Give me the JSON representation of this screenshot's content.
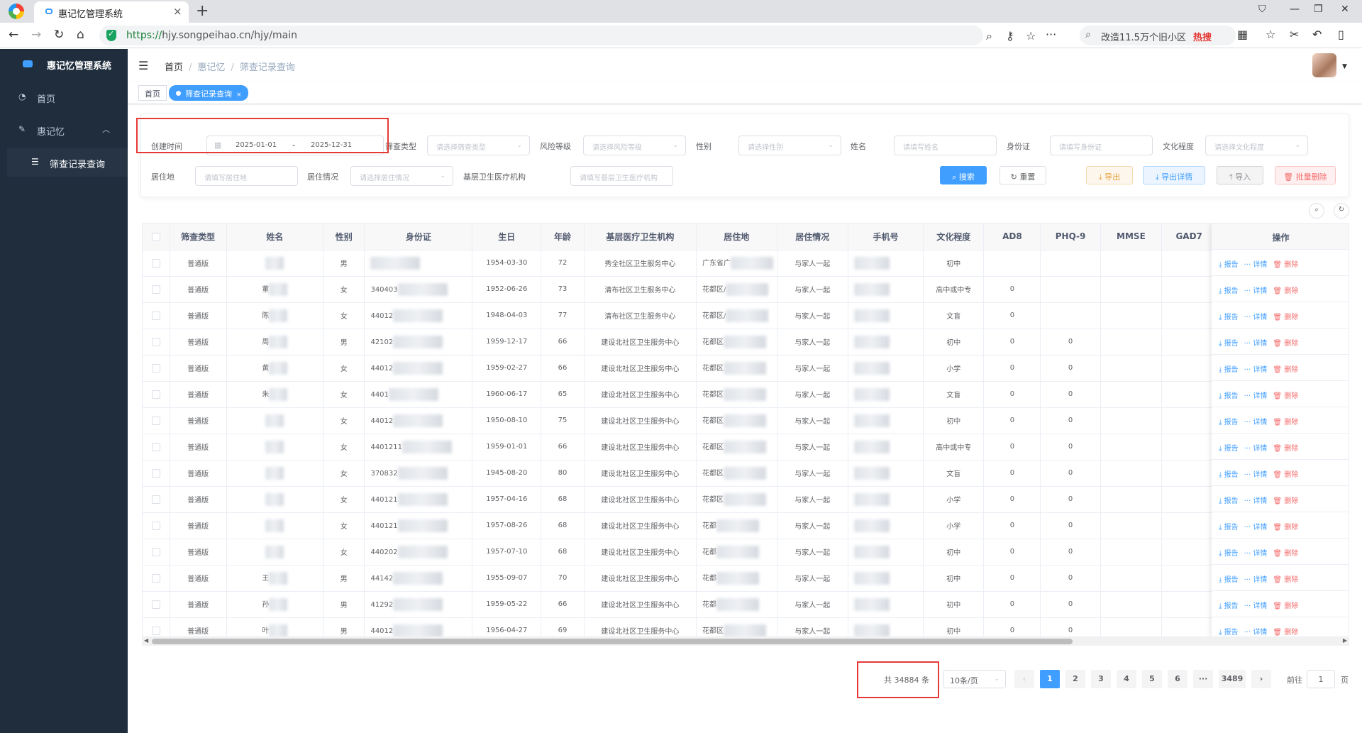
{
  "browser": {
    "tab_title": "惠记忆管理系统",
    "url_secure": "https://",
    "url_host": "hjy.songpeihao.cn",
    "url_path": "/hjy/main",
    "search_text": "改造11.5万个旧小区",
    "search_hot": "热搜"
  },
  "sidebar": {
    "title": "惠记忆管理系统",
    "items": [
      {
        "label": "首页",
        "icon": "dashboard-icon"
      },
      {
        "label": "惠记忆",
        "icon": "brain-icon"
      }
    ],
    "sub_item": {
      "label": "筛查记录查询",
      "icon": "list-icon"
    }
  },
  "header": {
    "breadcrumb": [
      "首页",
      "惠记忆",
      "筛查记录查询"
    ]
  },
  "tags": [
    "首页",
    "筛查记录查询"
  ],
  "filters": {
    "created_label": "创建时间",
    "date_start": "2025-01-01",
    "date_sep": "-",
    "date_end": "2025-12-31",
    "screen_type_label": "筛查类型",
    "screen_type_ph": "请选择筛查类型",
    "risk_label": "风险等级",
    "risk_ph": "请选择风险等级",
    "gender_label": "性别",
    "gender_ph": "请选择性别",
    "name_label": "姓名",
    "name_ph": "请填写姓名",
    "id_label": "身份证",
    "id_ph": "请填写身份证",
    "edu_label": "文化程度",
    "edu_ph": "请选择文化程度",
    "address_label": "居住地",
    "address_ph": "请填写居住地",
    "living_label": "居住情况",
    "living_ph": "请选择居住情况",
    "clinic_label": "基层卫生医疗机构",
    "clinic_ph": "请填写基层卫生医疗机构"
  },
  "buttons": {
    "search": "搜索",
    "reset": "重置",
    "export": "导出",
    "export_detail": "导出详情",
    "import": "导入",
    "batch_delete": "批量删除"
  },
  "table": {
    "headers": [
      "筛查类型",
      "姓名",
      "性别",
      "身份证",
      "生日",
      "年龄",
      "基层医疗卫生机构",
      "居住地",
      "居住情况",
      "手机号",
      "文化程度",
      "AD8",
      "PHQ-9",
      "MMSE",
      "GAD7"
    ],
    "ops_header": "操作",
    "ops": {
      "report": "报告",
      "detail": "详情",
      "delete": "删除"
    },
    "rows": [
      {
        "type": "普通版",
        "name": "",
        "gender": "男",
        "id": "",
        "birth": "1954-03-30",
        "age": "72",
        "clinic": "秀全社区卫生服务中心",
        "addr": "广东省广",
        "living": "与家人一起",
        "phone": "",
        "edu": "初中",
        "ad8": "",
        "phq9": "",
        "mmse": "",
        "gad7": ""
      },
      {
        "type": "普通版",
        "name": "董",
        "gender": "女",
        "id": "340403",
        "birth": "1952-06-26",
        "age": "73",
        "clinic": "清布社区卫生服务中心",
        "addr": "花都区/",
        "living": "与家人一起",
        "phone": "",
        "edu": "高中或中专",
        "ad8": "0",
        "phq9": "",
        "mmse": "",
        "gad7": ""
      },
      {
        "type": "普通版",
        "name": "陈",
        "gender": "女",
        "id": "44012",
        "birth": "1948-04-03",
        "age": "77",
        "clinic": "清布社区卫生服务中心",
        "addr": "花都区/",
        "living": "与家人一起",
        "phone": "",
        "edu": "文盲",
        "ad8": "0",
        "phq9": "",
        "mmse": "",
        "gad7": ""
      },
      {
        "type": "普通版",
        "name": "周",
        "gender": "男",
        "id": "42102",
        "birth": "1959-12-17",
        "age": "66",
        "clinic": "建设北社区卫生服务中心",
        "addr": "花都区",
        "living": "与家人一起",
        "phone": "",
        "edu": "初中",
        "ad8": "0",
        "phq9": "0",
        "mmse": "",
        "gad7": ""
      },
      {
        "type": "普通版",
        "name": "黄",
        "gender": "女",
        "id": "44012",
        "birth": "1959-02-27",
        "age": "66",
        "clinic": "建设北社区卫生服务中心",
        "addr": "花都区",
        "living": "与家人一起",
        "phone": "",
        "edu": "小学",
        "ad8": "0",
        "phq9": "0",
        "mmse": "",
        "gad7": ""
      },
      {
        "type": "普通版",
        "name": "朱",
        "gender": "女",
        "id": "4401",
        "birth": "1960-06-17",
        "age": "65",
        "clinic": "建设北社区卫生服务中心",
        "addr": "花都区",
        "living": "与家人一起",
        "phone": "",
        "edu": "文盲",
        "ad8": "0",
        "phq9": "0",
        "mmse": "",
        "gad7": ""
      },
      {
        "type": "普通版",
        "name": "",
        "gender": "女",
        "id": "44012",
        "birth": "1950-08-10",
        "age": "75",
        "clinic": "建设北社区卫生服务中心",
        "addr": "花都区",
        "living": "与家人一起",
        "phone": "",
        "edu": "初中",
        "ad8": "0",
        "phq9": "0",
        "mmse": "",
        "gad7": ""
      },
      {
        "type": "普通版",
        "name": "",
        "gender": "女",
        "id": "4401211",
        "birth": "1959-01-01",
        "age": "66",
        "clinic": "建设北社区卫生服务中心",
        "addr": "花都区",
        "living": "与家人一起",
        "phone": "",
        "edu": "高中或中专",
        "ad8": "0",
        "phq9": "0",
        "mmse": "",
        "gad7": ""
      },
      {
        "type": "普通版",
        "name": "",
        "gender": "女",
        "id": "370832",
        "birth": "1945-08-20",
        "age": "80",
        "clinic": "建设北社区卫生服务中心",
        "addr": "花都区",
        "living": "与家人一起",
        "phone": "",
        "edu": "文盲",
        "ad8": "0",
        "phq9": "0",
        "mmse": "",
        "gad7": ""
      },
      {
        "type": "普通版",
        "name": "",
        "gender": "女",
        "id": "440121",
        "birth": "1957-04-16",
        "age": "68",
        "clinic": "建设北社区卫生服务中心",
        "addr": "花都区",
        "living": "与家人一起",
        "phone": "",
        "edu": "小学",
        "ad8": "0",
        "phq9": "0",
        "mmse": "",
        "gad7": ""
      },
      {
        "type": "普通版",
        "name": "",
        "gender": "女",
        "id": "440121",
        "birth": "1957-08-26",
        "age": "68",
        "clinic": "建设北社区卫生服务中心",
        "addr": "花都",
        "living": "与家人一起",
        "phone": "",
        "edu": "小学",
        "ad8": "0",
        "phq9": "0",
        "mmse": "",
        "gad7": ""
      },
      {
        "type": "普通版",
        "name": "",
        "gender": "女",
        "id": "440202",
        "birth": "1957-07-10",
        "age": "68",
        "clinic": "建设北社区卫生服务中心",
        "addr": "花都",
        "living": "与家人一起",
        "phone": "",
        "edu": "初中",
        "ad8": "0",
        "phq9": "0",
        "mmse": "",
        "gad7": ""
      },
      {
        "type": "普通版",
        "name": "王",
        "gender": "男",
        "id": "44142",
        "birth": "1955-09-07",
        "age": "70",
        "clinic": "建设北社区卫生服务中心",
        "addr": "花都",
        "living": "与家人一起",
        "phone": "",
        "edu": "初中",
        "ad8": "0",
        "phq9": "0",
        "mmse": "",
        "gad7": ""
      },
      {
        "type": "普通版",
        "name": "孙",
        "gender": "男",
        "id": "41292",
        "birth": "1959-05-22",
        "age": "66",
        "clinic": "建设北社区卫生服务中心",
        "addr": "花都",
        "living": "与家人一起",
        "phone": "",
        "edu": "初中",
        "ad8": "0",
        "phq9": "0",
        "mmse": "",
        "gad7": ""
      },
      {
        "type": "普通版",
        "name": "叶",
        "gender": "男",
        "id": "44012",
        "birth": "1956-04-27",
        "age": "69",
        "clinic": "建设北社区卫生服务中心",
        "addr": "花都区",
        "living": "与家人一起",
        "phone": "",
        "edu": "初中",
        "ad8": "0",
        "phq9": "0",
        "mmse": "",
        "gad7": ""
      }
    ]
  },
  "pagination": {
    "total": "共 34884 条",
    "page_size": "10条/页",
    "pages": [
      "1",
      "2",
      "3",
      "4",
      "5",
      "6",
      "···",
      "3489"
    ],
    "goto_label": "前往",
    "goto_value": "1",
    "page_label": "页"
  }
}
